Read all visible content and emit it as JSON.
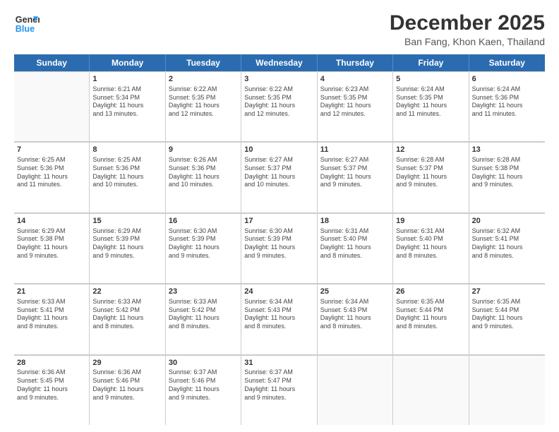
{
  "logo": {
    "line1": "General",
    "line2": "Blue"
  },
  "title": "December 2025",
  "subtitle": "Ban Fang, Khon Kaen, Thailand",
  "weekdays": [
    "Sunday",
    "Monday",
    "Tuesday",
    "Wednesday",
    "Thursday",
    "Friday",
    "Saturday"
  ],
  "weeks": [
    [
      {
        "date": "",
        "info": ""
      },
      {
        "date": "1",
        "info": "Sunrise: 6:21 AM\nSunset: 5:34 PM\nDaylight: 11 hours\nand 13 minutes."
      },
      {
        "date": "2",
        "info": "Sunrise: 6:22 AM\nSunset: 5:35 PM\nDaylight: 11 hours\nand 12 minutes."
      },
      {
        "date": "3",
        "info": "Sunrise: 6:22 AM\nSunset: 5:35 PM\nDaylight: 11 hours\nand 12 minutes."
      },
      {
        "date": "4",
        "info": "Sunrise: 6:23 AM\nSunset: 5:35 PM\nDaylight: 11 hours\nand 12 minutes."
      },
      {
        "date": "5",
        "info": "Sunrise: 6:24 AM\nSunset: 5:35 PM\nDaylight: 11 hours\nand 11 minutes."
      },
      {
        "date": "6",
        "info": "Sunrise: 6:24 AM\nSunset: 5:36 PM\nDaylight: 11 hours\nand 11 minutes."
      }
    ],
    [
      {
        "date": "7",
        "info": "Sunrise: 6:25 AM\nSunset: 5:36 PM\nDaylight: 11 hours\nand 11 minutes."
      },
      {
        "date": "8",
        "info": "Sunrise: 6:25 AM\nSunset: 5:36 PM\nDaylight: 11 hours\nand 10 minutes."
      },
      {
        "date": "9",
        "info": "Sunrise: 6:26 AM\nSunset: 5:36 PM\nDaylight: 11 hours\nand 10 minutes."
      },
      {
        "date": "10",
        "info": "Sunrise: 6:27 AM\nSunset: 5:37 PM\nDaylight: 11 hours\nand 10 minutes."
      },
      {
        "date": "11",
        "info": "Sunrise: 6:27 AM\nSunset: 5:37 PM\nDaylight: 11 hours\nand 9 minutes."
      },
      {
        "date": "12",
        "info": "Sunrise: 6:28 AM\nSunset: 5:37 PM\nDaylight: 11 hours\nand 9 minutes."
      },
      {
        "date": "13",
        "info": "Sunrise: 6:28 AM\nSunset: 5:38 PM\nDaylight: 11 hours\nand 9 minutes."
      }
    ],
    [
      {
        "date": "14",
        "info": "Sunrise: 6:29 AM\nSunset: 5:38 PM\nDaylight: 11 hours\nand 9 minutes."
      },
      {
        "date": "15",
        "info": "Sunrise: 6:29 AM\nSunset: 5:39 PM\nDaylight: 11 hours\nand 9 minutes."
      },
      {
        "date": "16",
        "info": "Sunrise: 6:30 AM\nSunset: 5:39 PM\nDaylight: 11 hours\nand 9 minutes."
      },
      {
        "date": "17",
        "info": "Sunrise: 6:30 AM\nSunset: 5:39 PM\nDaylight: 11 hours\nand 9 minutes."
      },
      {
        "date": "18",
        "info": "Sunrise: 6:31 AM\nSunset: 5:40 PM\nDaylight: 11 hours\nand 8 minutes."
      },
      {
        "date": "19",
        "info": "Sunrise: 6:31 AM\nSunset: 5:40 PM\nDaylight: 11 hours\nand 8 minutes."
      },
      {
        "date": "20",
        "info": "Sunrise: 6:32 AM\nSunset: 5:41 PM\nDaylight: 11 hours\nand 8 minutes."
      }
    ],
    [
      {
        "date": "21",
        "info": "Sunrise: 6:33 AM\nSunset: 5:41 PM\nDaylight: 11 hours\nand 8 minutes."
      },
      {
        "date": "22",
        "info": "Sunrise: 6:33 AM\nSunset: 5:42 PM\nDaylight: 11 hours\nand 8 minutes."
      },
      {
        "date": "23",
        "info": "Sunrise: 6:33 AM\nSunset: 5:42 PM\nDaylight: 11 hours\nand 8 minutes."
      },
      {
        "date": "24",
        "info": "Sunrise: 6:34 AM\nSunset: 5:43 PM\nDaylight: 11 hours\nand 8 minutes."
      },
      {
        "date": "25",
        "info": "Sunrise: 6:34 AM\nSunset: 5:43 PM\nDaylight: 11 hours\nand 8 minutes."
      },
      {
        "date": "26",
        "info": "Sunrise: 6:35 AM\nSunset: 5:44 PM\nDaylight: 11 hours\nand 8 minutes."
      },
      {
        "date": "27",
        "info": "Sunrise: 6:35 AM\nSunset: 5:44 PM\nDaylight: 11 hours\nand 9 minutes."
      }
    ],
    [
      {
        "date": "28",
        "info": "Sunrise: 6:36 AM\nSunset: 5:45 PM\nDaylight: 11 hours\nand 9 minutes."
      },
      {
        "date": "29",
        "info": "Sunrise: 6:36 AM\nSunset: 5:46 PM\nDaylight: 11 hours\nand 9 minutes."
      },
      {
        "date": "30",
        "info": "Sunrise: 6:37 AM\nSunset: 5:46 PM\nDaylight: 11 hours\nand 9 minutes."
      },
      {
        "date": "31",
        "info": "Sunrise: 6:37 AM\nSunset: 5:47 PM\nDaylight: 11 hours\nand 9 minutes."
      },
      {
        "date": "",
        "info": ""
      },
      {
        "date": "",
        "info": ""
      },
      {
        "date": "",
        "info": ""
      }
    ]
  ]
}
